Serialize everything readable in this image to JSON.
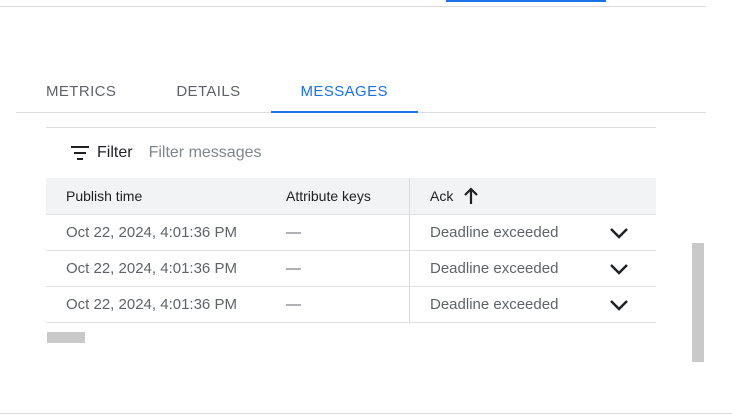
{
  "tabs": [
    {
      "label": "METRICS",
      "active": false
    },
    {
      "label": "DETAILS",
      "active": false
    },
    {
      "label": "MESSAGES",
      "active": true
    }
  ],
  "filter": {
    "label": "Filter",
    "placeholder": "Filter messages",
    "icon": "filter-list-icon"
  },
  "table": {
    "columns": [
      "Publish time",
      "Attribute keys",
      "Ack"
    ],
    "sort_icon": "arrow-upward-icon",
    "rows": [
      {
        "publish_time": "Oct 22, 2024, 4:01:36 PM",
        "attribute_keys": "—",
        "ack": "Deadline exceeded"
      },
      {
        "publish_time": "Oct 22, 2024, 4:01:36 PM",
        "attribute_keys": "—",
        "ack": "Deadline exceeded"
      },
      {
        "publish_time": "Oct 22, 2024, 4:01:36 PM",
        "attribute_keys": "—",
        "ack": "Deadline exceeded"
      }
    ]
  },
  "colors": {
    "accent": "#1a73e8",
    "text": "#202124",
    "muted": "#5f6368",
    "header_bg": "#f1f3f4",
    "divider": "#dadce0"
  }
}
